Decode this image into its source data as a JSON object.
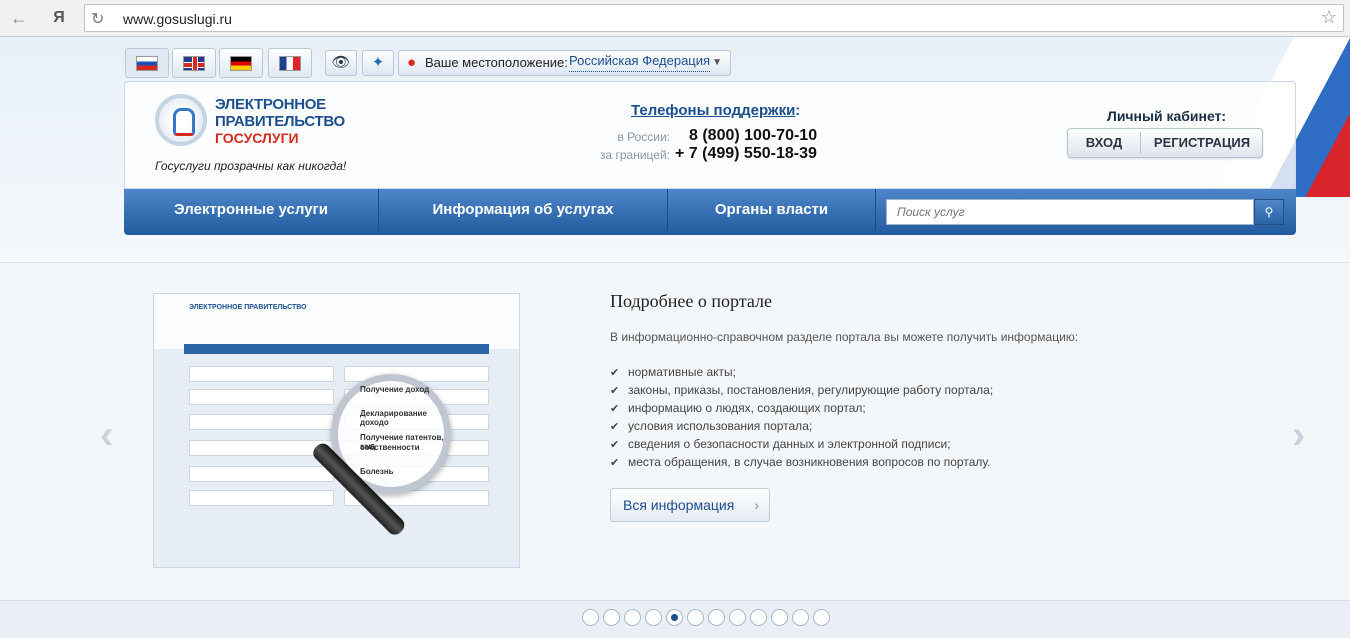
{
  "browser": {
    "back_icon": "back-arrow-icon",
    "yandex_label": "Я",
    "url": "www.gosuslugi.ru"
  },
  "toolbar": {
    "location_label": "Ваше местоположение:",
    "location_value": "Российская Федерация"
  },
  "header": {
    "logo_line1": "ЭЛЕКТРОННОЕ",
    "logo_line2": "ПРАВИТЕЛЬСТВО",
    "logo_line3": "ГОСУСЛУГИ",
    "tagline": "Госуслуги прозрачны как никогда!",
    "phones_title": "Телефоны поддержки",
    "phones_colon": ":",
    "phone_ru_label": "в России:",
    "phone_ru": "8 (800) 100-70-10",
    "phone_abroad_label": "за границей:",
    "phone_abroad": "+ 7 (499) 550-18-39",
    "cabinet_title": "Личный кабинет:",
    "login": "ВХОД",
    "register": "РЕГИСТРАЦИЯ"
  },
  "nav": {
    "items": [
      "Электронные услуги",
      "Информация об услугах",
      "Органы власти"
    ],
    "search_placeholder": "Поиск услуг"
  },
  "slide": {
    "thumb_title": "ЭЛЕКТРОННОЕ ПРАВИТЕЛЬСТВО",
    "lens_lines": [
      "Получение доход",
      "Декларирование доходо",
      "Получение патентов, защ",
      "собственности",
      "Болезнь"
    ],
    "title": "Подробнее о портале",
    "intro": "В информационно-справочном разделе портала вы можете получить информацию:",
    "list": [
      "нормативные акты;",
      "законы, приказы, постановления, регулирующие работу портала;",
      "информацию о людях, создающих портал;",
      "условия использования портала;",
      "сведения о безопасности данных и электронной подписи;",
      "места обращения, в случае возникновения вопросов по порталу."
    ],
    "more_button": "Вся информация"
  },
  "pager": {
    "total": 12,
    "active_index": 4
  },
  "colors": {
    "brand_blue": "#1d4f8f",
    "brand_red": "#d52b1e"
  }
}
